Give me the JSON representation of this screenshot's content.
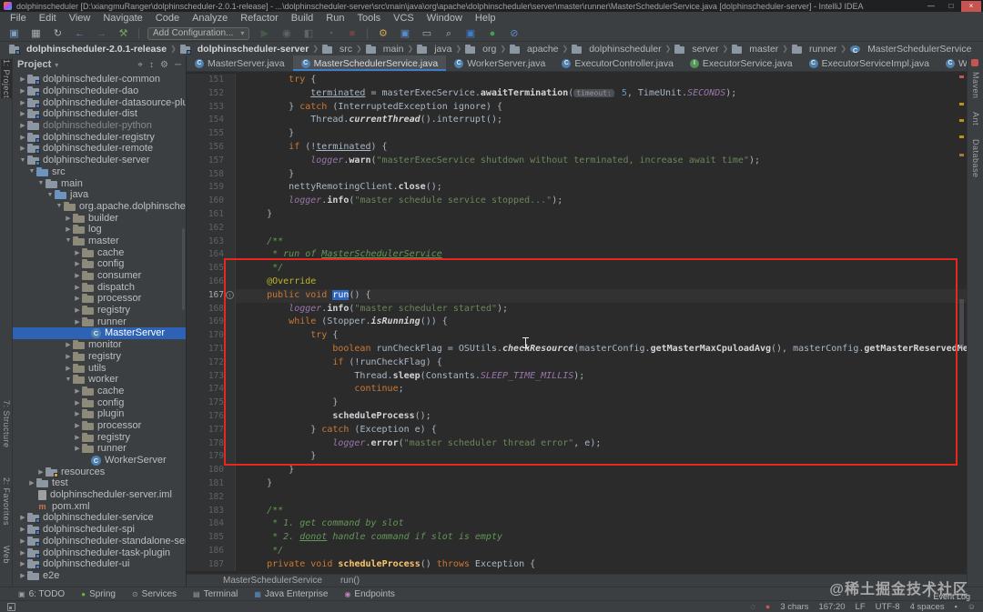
{
  "window": {
    "title": "dolphinscheduler [D:\\xiangmuRanger\\dolphinscheduler-2.0.1-release] - ...\\dolphinscheduler-server\\src\\main\\java\\org\\apache\\dolphinscheduler\\server\\master\\runner\\MasterSchedulerService.java [dolphinscheduler-server] - IntelliJ IDEA",
    "controls": [
      "minimize-icon",
      "maximize-icon",
      "close-icon"
    ]
  },
  "menu": [
    "File",
    "Edit",
    "View",
    "Navigate",
    "Code",
    "Analyze",
    "Refactor",
    "Build",
    "Run",
    "Tools",
    "VCS",
    "Window",
    "Help"
  ],
  "toolbar": {
    "left_icons": [
      "open-project-icon",
      "save-all-icon",
      "sync-icon",
      "back-icon",
      "forward-icon",
      "build-project-icon"
    ],
    "run_config_label": "Add Configuration...",
    "run_icons": [
      "run-icon",
      "debug-icon",
      "run-coverage-icon",
      "profiler-icon",
      "stop-icon"
    ],
    "right_icons": [
      "settings-wrench-icon",
      "project-structure-icon",
      "window-icon",
      "search-everywhere-icon",
      "plugin-icon",
      "status-ok-icon",
      "power-save-icon"
    ]
  },
  "breadcrumbs": [
    {
      "type": "mod",
      "label": "dolphinscheduler-2.0.1-release"
    },
    {
      "type": "mod",
      "label": "dolphinscheduler-server"
    },
    {
      "type": "fold",
      "label": "src"
    },
    {
      "type": "fold",
      "label": "main"
    },
    {
      "type": "fold",
      "label": "java"
    },
    {
      "type": "fold",
      "label": "org"
    },
    {
      "type": "fold",
      "label": "apache"
    },
    {
      "type": "fold",
      "label": "dolphinscheduler"
    },
    {
      "type": "fold",
      "label": "server"
    },
    {
      "type": "fold",
      "label": "master"
    },
    {
      "type": "fold",
      "label": "runner"
    },
    {
      "type": "cls",
      "label": "MasterSchedulerService"
    }
  ],
  "left_stripe": [
    "1: Project",
    "7: Structure",
    "2: Favorites",
    "Web"
  ],
  "right_stripe": [
    "Maven",
    "Ant",
    "Database"
  ],
  "project": {
    "header": "Project",
    "header_icons": [
      "locate-icon",
      "expand-collapse-icon",
      "settings-icon",
      "hide-icon"
    ],
    "tree": [
      {
        "l": "dolphinscheduler-common",
        "i": 0,
        "a": "r",
        "ic": "mod"
      },
      {
        "l": "dolphinscheduler-dao",
        "i": 0,
        "a": "r",
        "ic": "mod"
      },
      {
        "l": "dolphinscheduler-datasource-plugin",
        "i": 0,
        "a": "r",
        "ic": "mod"
      },
      {
        "l": "dolphinscheduler-dist",
        "i": 0,
        "a": "r",
        "ic": "mod"
      },
      {
        "l": "dolphinscheduler-python",
        "i": 0,
        "a": "r",
        "ic": "fold",
        "dim": true
      },
      {
        "l": "dolphinscheduler-registry",
        "i": 0,
        "a": "r",
        "ic": "mod"
      },
      {
        "l": "dolphinscheduler-remote",
        "i": 0,
        "a": "r",
        "ic": "mod"
      },
      {
        "l": "dolphinscheduler-server",
        "i": 0,
        "a": "d",
        "ic": "mod"
      },
      {
        "l": "src",
        "i": 1,
        "a": "d",
        "ic": "src"
      },
      {
        "l": "main",
        "i": 2,
        "a": "d",
        "ic": "fold"
      },
      {
        "l": "java",
        "i": 3,
        "a": "d",
        "ic": "src"
      },
      {
        "l": "org.apache.dolphinscheduler.",
        "i": 4,
        "a": "d",
        "ic": "pkg"
      },
      {
        "l": "builder",
        "i": 5,
        "a": "r",
        "ic": "pkg"
      },
      {
        "l": "log",
        "i": 5,
        "a": "r",
        "ic": "pkg"
      },
      {
        "l": "master",
        "i": 5,
        "a": "d",
        "ic": "pkg"
      },
      {
        "l": "cache",
        "i": 6,
        "a": "r",
        "ic": "pkg"
      },
      {
        "l": "config",
        "i": 6,
        "a": "r",
        "ic": "pkg"
      },
      {
        "l": "consumer",
        "i": 6,
        "a": "r",
        "ic": "pkg"
      },
      {
        "l": "dispatch",
        "i": 6,
        "a": "r",
        "ic": "pkg"
      },
      {
        "l": "processor",
        "i": 6,
        "a": "r",
        "ic": "pkg"
      },
      {
        "l": "registry",
        "i": 6,
        "a": "r",
        "ic": "pkg"
      },
      {
        "l": "runner",
        "i": 6,
        "a": "r",
        "ic": "pkg"
      },
      {
        "l": "MasterServer",
        "i": 7,
        "ic": "cls",
        "sel": true
      },
      {
        "l": "monitor",
        "i": 5,
        "a": "r",
        "ic": "pkg"
      },
      {
        "l": "registry",
        "i": 5,
        "a": "r",
        "ic": "pkg"
      },
      {
        "l": "utils",
        "i": 5,
        "a": "r",
        "ic": "pkg"
      },
      {
        "l": "worker",
        "i": 5,
        "a": "d",
        "ic": "pkg"
      },
      {
        "l": "cache",
        "i": 6,
        "a": "r",
        "ic": "pkg"
      },
      {
        "l": "config",
        "i": 6,
        "a": "r",
        "ic": "pkg"
      },
      {
        "l": "plugin",
        "i": 6,
        "a": "r",
        "ic": "pkg"
      },
      {
        "l": "processor",
        "i": 6,
        "a": "r",
        "ic": "pkg"
      },
      {
        "l": "registry",
        "i": 6,
        "a": "r",
        "ic": "pkg"
      },
      {
        "l": "runner",
        "i": 6,
        "a": "r",
        "ic": "pkg"
      },
      {
        "l": "WorkerServer",
        "i": 7,
        "ic": "cls"
      },
      {
        "l": "resources",
        "i": 2,
        "a": "r",
        "ic": "res"
      },
      {
        "l": "test",
        "i": 1,
        "a": "r",
        "ic": "fold"
      },
      {
        "l": "dolphinscheduler-server.iml",
        "i": 1,
        "ic": "file"
      },
      {
        "l": "pom.xml",
        "i": 1,
        "ic": "mvn"
      },
      {
        "l": "dolphinscheduler-service",
        "i": 0,
        "a": "r",
        "ic": "mod"
      },
      {
        "l": "dolphinscheduler-spi",
        "i": 0,
        "a": "r",
        "ic": "mod"
      },
      {
        "l": "dolphinscheduler-standalone-server",
        "i": 0,
        "a": "r",
        "ic": "mod"
      },
      {
        "l": "dolphinscheduler-task-plugin",
        "i": 0,
        "a": "r",
        "ic": "mod"
      },
      {
        "l": "dolphinscheduler-ui",
        "i": 0,
        "a": "r",
        "ic": "mod"
      },
      {
        "l": "e2e",
        "i": 0,
        "a": "r",
        "ic": "fold"
      }
    ]
  },
  "tabs": [
    {
      "label": "MasterServer.java",
      "type": "c"
    },
    {
      "label": "MasterSchedulerService.java",
      "type": "c",
      "active": true
    },
    {
      "label": "WorkerServer.java",
      "type": "c"
    },
    {
      "label": "ExecutorController.java",
      "type": "c"
    },
    {
      "label": "ExecutorService.java",
      "type": "i"
    },
    {
      "label": "ExecutorServiceImpl.java",
      "type": "c"
    },
    {
      "label": "WorkerRegistryClient.java",
      "type": "c"
    }
  ],
  "tabs_extra_icons": [
    "hidden-tabs-icon",
    "tab-options-icon"
  ],
  "editor": {
    "lines": [
      {
        "n": 151,
        "segs": [
          [
            "pl",
            "        "
          ],
          [
            "kw",
            "try"
          ],
          [
            "pl",
            " {"
          ]
        ]
      },
      {
        "n": 152,
        "segs": [
          [
            "pl",
            "            "
          ],
          [
            "ul",
            "terminated"
          ],
          [
            "pl",
            " = masterExecService."
          ],
          [
            "mc",
            "awaitTermination"
          ],
          [
            "pl",
            "("
          ],
          [
            "hint",
            "timeout:"
          ],
          [
            "pl",
            " "
          ],
          [
            "num",
            "5"
          ],
          [
            "pl",
            ", TimeUnit."
          ],
          [
            "cst",
            "SECONDS"
          ],
          [
            "pl",
            ");"
          ]
        ]
      },
      {
        "n": 153,
        "segs": [
          [
            "pl",
            "        } "
          ],
          [
            "kw",
            "catch"
          ],
          [
            "pl",
            " (InterruptedException ignore) {"
          ]
        ]
      },
      {
        "n": 154,
        "segs": [
          [
            "pl",
            "            Thread."
          ],
          [
            "smi",
            "currentThread"
          ],
          [
            "pl",
            "().interrupt();"
          ]
        ]
      },
      {
        "n": 155,
        "segs": [
          [
            "pl",
            "        }"
          ]
        ]
      },
      {
        "n": 156,
        "segs": [
          [
            "pl",
            "        "
          ],
          [
            "kw",
            "if"
          ],
          [
            "pl",
            " (!"
          ],
          [
            "ul",
            "terminated"
          ],
          [
            "pl",
            ") {"
          ]
        ]
      },
      {
        "n": 157,
        "segs": [
          [
            "pl",
            "            "
          ],
          [
            "fld",
            "logger"
          ],
          [
            "pl",
            "."
          ],
          [
            "mc",
            "warn"
          ],
          [
            "pl",
            "("
          ],
          [
            "str",
            "\"masterExecService shutdown without terminated, increase await time\""
          ],
          [
            "pl",
            ");"
          ]
        ]
      },
      {
        "n": 158,
        "segs": [
          [
            "pl",
            "        }"
          ]
        ]
      },
      {
        "n": 159,
        "segs": [
          [
            "pl",
            "        nettyRemotingClient."
          ],
          [
            "mc",
            "close"
          ],
          [
            "pl",
            "();"
          ]
        ]
      },
      {
        "n": 160,
        "segs": [
          [
            "pl",
            "        "
          ],
          [
            "fld",
            "logger"
          ],
          [
            "pl",
            "."
          ],
          [
            "mc",
            "info"
          ],
          [
            "pl",
            "("
          ],
          [
            "str",
            "\"master schedule service stopped...\""
          ],
          [
            "pl",
            ");"
          ]
        ]
      },
      {
        "n": 161,
        "segs": [
          [
            "pl",
            "    }"
          ]
        ]
      },
      {
        "n": 162,
        "segs": []
      },
      {
        "n": 163,
        "segs": [
          [
            "com",
            "    /**"
          ]
        ]
      },
      {
        "n": 164,
        "segs": [
          [
            "com",
            "     * run of "
          ],
          [
            "comu",
            "MasterSchedulerService"
          ]
        ]
      },
      {
        "n": 165,
        "segs": [
          [
            "com",
            "     */"
          ]
        ]
      },
      {
        "n": 166,
        "segs": [
          [
            "pl",
            "    "
          ],
          [
            "ann",
            "@Override"
          ]
        ]
      },
      {
        "n": 167,
        "cur": true,
        "marker": "override-icon",
        "segs": [
          [
            "pl",
            "    "
          ],
          [
            "kw",
            "public"
          ],
          [
            "pl",
            " "
          ],
          [
            "kw",
            "void"
          ],
          [
            "pl",
            " "
          ],
          [
            "sel",
            "run"
          ],
          [
            "pl",
            "() {"
          ]
        ]
      },
      {
        "n": 168,
        "segs": [
          [
            "pl",
            "        "
          ],
          [
            "fld",
            "logger"
          ],
          [
            "pl",
            "."
          ],
          [
            "mc",
            "info"
          ],
          [
            "pl",
            "("
          ],
          [
            "str",
            "\"master scheduler started\""
          ],
          [
            "pl",
            ");"
          ]
        ]
      },
      {
        "n": 169,
        "segs": [
          [
            "pl",
            "        "
          ],
          [
            "kw",
            "while"
          ],
          [
            "pl",
            " (Stopper."
          ],
          [
            "smi",
            "isRunning"
          ],
          [
            "pl",
            "()) {"
          ]
        ]
      },
      {
        "n": 170,
        "segs": [
          [
            "pl",
            "            "
          ],
          [
            "kw",
            "try"
          ],
          [
            "pl",
            " {"
          ]
        ]
      },
      {
        "n": 171,
        "segs": [
          [
            "pl",
            "                "
          ],
          [
            "kw",
            "boolean"
          ],
          [
            "pl",
            " runCheckFlag = OSUtils."
          ],
          [
            "smi",
            "checkResource"
          ],
          [
            "pl",
            "(masterConfig."
          ],
          [
            "mc",
            "getMasterMaxCpuloadAvg"
          ],
          [
            "pl",
            "(), masterConfig."
          ],
          [
            "mc",
            "getMasterReservedMemory"
          ],
          [
            "pl",
            "());"
          ]
        ]
      },
      {
        "n": 172,
        "segs": [
          [
            "pl",
            "                "
          ],
          [
            "kw",
            "if"
          ],
          [
            "pl",
            " (!runCheckFlag) {"
          ]
        ]
      },
      {
        "n": 173,
        "segs": [
          [
            "pl",
            "                    Thread."
          ],
          [
            "mc",
            "sleep"
          ],
          [
            "pl",
            "(Constants."
          ],
          [
            "cst",
            "SLEEP_TIME_MILLIS"
          ],
          [
            "pl",
            ");"
          ]
        ]
      },
      {
        "n": 174,
        "segs": [
          [
            "pl",
            "                    "
          ],
          [
            "kw",
            "continue"
          ],
          [
            "pl",
            ";"
          ]
        ]
      },
      {
        "n": 175,
        "segs": [
          [
            "pl",
            "                }"
          ]
        ]
      },
      {
        "n": 176,
        "segs": [
          [
            "pl",
            "                "
          ],
          [
            "mc",
            "scheduleProcess"
          ],
          [
            "pl",
            "();"
          ]
        ]
      },
      {
        "n": 177,
        "segs": [
          [
            "pl",
            "            } "
          ],
          [
            "kw",
            "catch"
          ],
          [
            "pl",
            " (Exception e) {"
          ]
        ]
      },
      {
        "n": 178,
        "segs": [
          [
            "pl",
            "                "
          ],
          [
            "fld",
            "logger"
          ],
          [
            "pl",
            "."
          ],
          [
            "mc",
            "error"
          ],
          [
            "pl",
            "("
          ],
          [
            "str",
            "\"master scheduler thread error\""
          ],
          [
            "pl",
            ", e);"
          ]
        ]
      },
      {
        "n": 179,
        "segs": [
          [
            "pl",
            "            }"
          ]
        ]
      },
      {
        "n": 180,
        "segs": [
          [
            "pl",
            "        }"
          ]
        ]
      },
      {
        "n": 181,
        "segs": [
          [
            "pl",
            "    }"
          ]
        ]
      },
      {
        "n": 182,
        "segs": []
      },
      {
        "n": 183,
        "segs": [
          [
            "com",
            "    /**"
          ]
        ]
      },
      {
        "n": 184,
        "segs": [
          [
            "com",
            "     * 1. get command by slot"
          ]
        ]
      },
      {
        "n": 185,
        "segs": [
          [
            "com",
            "     * 2. "
          ],
          [
            "comu",
            "donot"
          ],
          [
            "com",
            " handle command if slot is empty"
          ]
        ]
      },
      {
        "n": 186,
        "segs": [
          [
            "com",
            "     */"
          ]
        ]
      },
      {
        "n": 187,
        "segs": [
          [
            "pl",
            "    "
          ],
          [
            "kw",
            "private"
          ],
          [
            "pl",
            " "
          ],
          [
            "kw",
            "void"
          ],
          [
            "pl",
            " "
          ],
          [
            "mdecl",
            "scheduleProcess"
          ],
          [
            "pl",
            "() "
          ],
          [
            "kw",
            "throws"
          ],
          [
            "pl",
            " Exception {"
          ]
        ]
      }
    ]
  },
  "editor_breadcrumb": [
    "MasterSchedulerService",
    "run()"
  ],
  "bottom_bar": [
    {
      "label": "6: TODO",
      "icon": "todo-icon",
      "color": "#9da0a2"
    },
    {
      "label": "Spring",
      "icon": "spring-icon",
      "color": "#6db33f"
    },
    {
      "label": "Services",
      "icon": "services-icon",
      "color": "#9da0a2"
    },
    {
      "label": "Terminal",
      "icon": "terminal-icon",
      "color": "#9da0a2"
    },
    {
      "label": "Java Enterprise",
      "icon": "java-enterprise-icon",
      "color": "#5b8cc9"
    },
    {
      "label": "Endpoints",
      "icon": "endpoints-icon",
      "color": "#c77dbb"
    }
  ],
  "status": {
    "left_icon": "toolwindow-switcher-icon",
    "pre_icons": [
      "mute-breakpoints-icon",
      "notification-icon"
    ],
    "chars": "3 chars",
    "caret": "167:20",
    "line_sep": "LF",
    "encoding": "UTF-8",
    "indent": "4 spaces",
    "post_icons": [
      "lock-icon",
      "hector-icon"
    ]
  },
  "event_log_label": "Event Log",
  "watermark": "@稀土掘金技术社区",
  "colors": {
    "accent_blue": "#3d7dcc",
    "selection_blue": "#2d62b5",
    "annotation_red": "#e8271f",
    "editor_bg": "#2b2b2b",
    "panel_bg": "#3c3f41"
  }
}
